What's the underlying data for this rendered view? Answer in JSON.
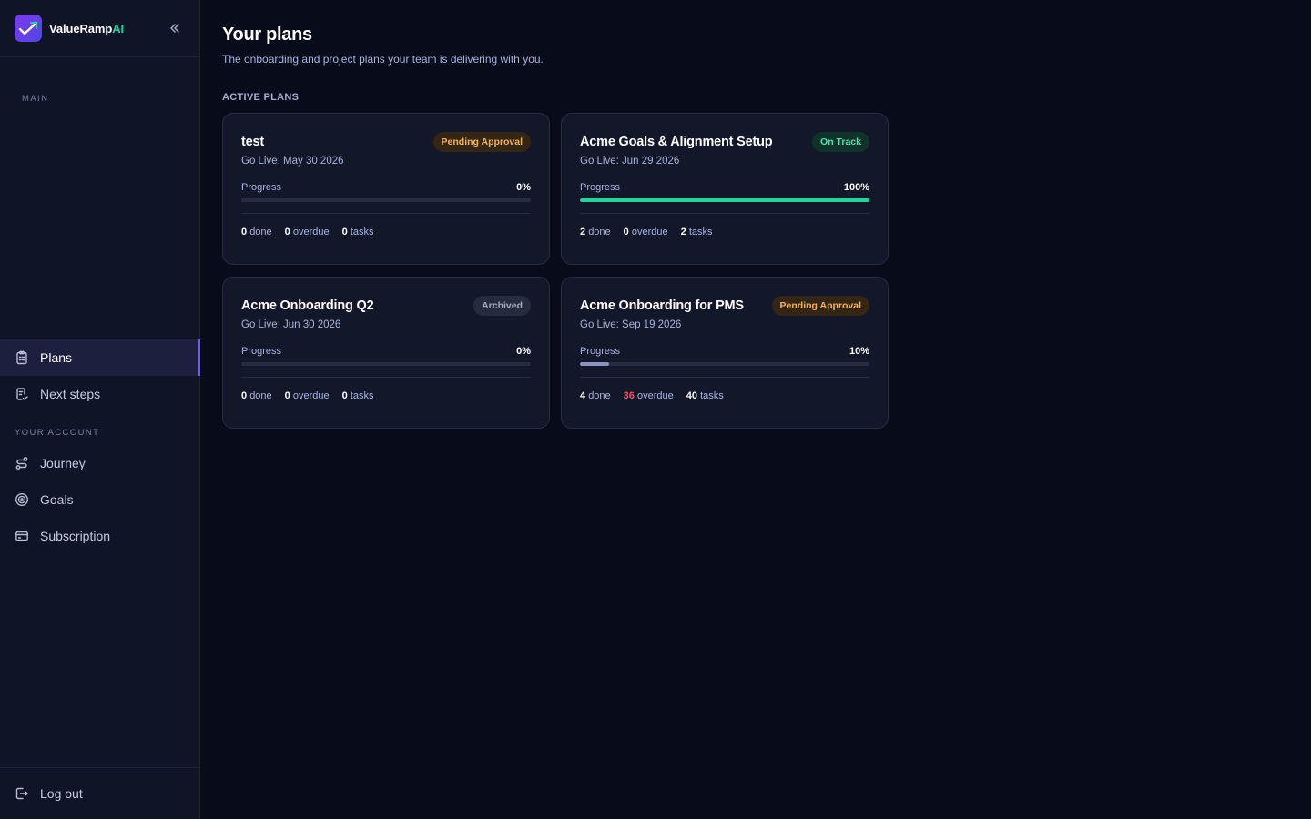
{
  "brand": {
    "name_main": "ValueRamp",
    "name_suffix": "AI"
  },
  "sidebar": {
    "section_main": "MAIN",
    "section_account": "YOUR ACCOUNT",
    "main_items": [
      {
        "label": "Plans",
        "icon": "clipboard-icon",
        "active": true
      },
      {
        "label": "Next steps",
        "icon": "checklist-icon",
        "active": false
      }
    ],
    "account_items": [
      {
        "label": "Journey",
        "icon": "route-icon"
      },
      {
        "label": "Goals",
        "icon": "target-icon"
      },
      {
        "label": "Subscription",
        "icon": "credit-card-icon"
      }
    ],
    "logout_label": "Log out"
  },
  "page": {
    "title": "Your plans",
    "subtitle": "The onboarding and project plans your team is delivering with you.",
    "section_label": "ACTIVE PLANS"
  },
  "plans": [
    {
      "title": "test",
      "badge": "Pending Approval",
      "badge_type": "pending",
      "golive": "Go Live: May 30 2026",
      "progress_label": "Progress",
      "progress_pct": "0%",
      "progress": 0,
      "bar_color": "#22d39a",
      "done": "0",
      "done_label": "done",
      "overdue": "0",
      "overdue_label": "overdue",
      "tasks": "0",
      "tasks_label": "tasks",
      "overdue_alert": false
    },
    {
      "title": "Acme Goals & Alignment Setup",
      "badge": "On Track",
      "badge_type": "ontrack",
      "golive": "Go Live: Jun 29 2026",
      "progress_label": "Progress",
      "progress_pct": "100%",
      "progress": 100,
      "bar_color": "#22d39a",
      "done": "2",
      "done_label": "done",
      "overdue": "0",
      "overdue_label": "overdue",
      "tasks": "2",
      "tasks_label": "tasks",
      "overdue_alert": false
    },
    {
      "title": "Acme Onboarding Q2",
      "badge": "Archived",
      "badge_type": "archived",
      "golive": "Go Live: Jun 30 2026",
      "progress_label": "Progress",
      "progress_pct": "0%",
      "progress": 0,
      "bar_color": "#22d39a",
      "done": "0",
      "done_label": "done",
      "overdue": "0",
      "overdue_label": "overdue",
      "tasks": "0",
      "tasks_label": "tasks",
      "overdue_alert": false
    },
    {
      "title": "Acme Onboarding for PMS",
      "badge": "Pending Approval",
      "badge_type": "pending",
      "golive": "Go Live: Sep 19 2026",
      "progress_label": "Progress",
      "progress_pct": "10%",
      "progress": 10,
      "bar_color": "#8c93bd",
      "done": "4",
      "done_label": "done",
      "overdue": "36",
      "overdue_label": "overdue",
      "tasks": "40",
      "tasks_label": "tasks",
      "overdue_alert": true
    }
  ]
}
